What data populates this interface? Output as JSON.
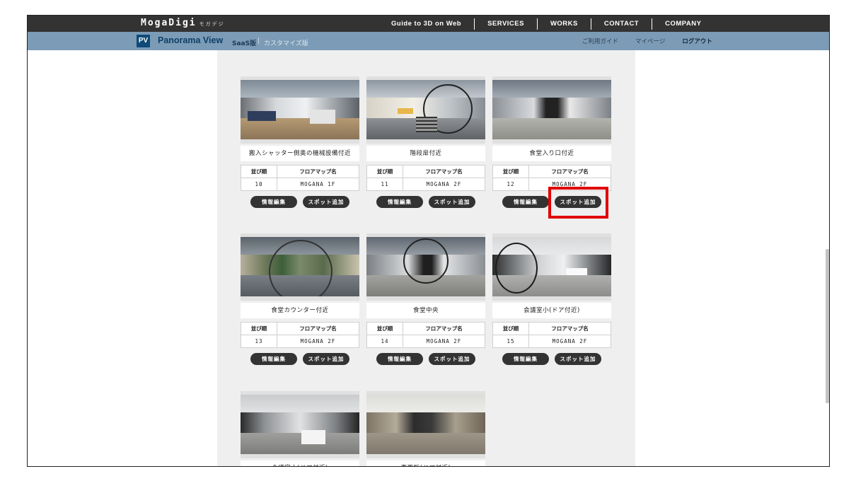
{
  "header": {
    "logo": "MogaDigi",
    "logo_sub": "モガデジ",
    "nav": [
      "Guide to 3D on Web",
      "SERVICES",
      "WORKS",
      "CONTACT",
      "COMPANY"
    ]
  },
  "subheader": {
    "badge": "PV",
    "title": "Panorama View",
    "saas": "SaaS版",
    "separator": "|",
    "custom": "カスタマイズ版",
    "links": [
      "ご利用ガイド",
      "マイページ",
      "ログアウト"
    ]
  },
  "table_headers": {
    "order": "並び順",
    "floor_map": "フロアマップ名"
  },
  "buttons": {
    "edit_info": "情報編集",
    "add_spot": "スポット追加"
  },
  "cards": [
    {
      "title": "搬入シャッター側奥の機械設備付近",
      "order": "10",
      "floor": "MOGANA 1F"
    },
    {
      "title": "階段扉付近",
      "order": "11",
      "floor": "MOGANA 2F"
    },
    {
      "title": "食堂入り口付近",
      "order": "12",
      "floor": "MOGANA 2F"
    },
    {
      "title": "食堂カウンター付近",
      "order": "13",
      "floor": "MOGANA 2F"
    },
    {
      "title": "食堂中央",
      "order": "14",
      "floor": "MOGANA 2F"
    },
    {
      "title": "会議室小(ドア付近)",
      "order": "15",
      "floor": "MOGANA 2F"
    },
    {
      "title": "会議室大(ドア付近)"
    },
    {
      "title": "事務所(ドア付近)"
    }
  ],
  "colors": {
    "topbar": "#333333",
    "subbar": "#7b9bb6",
    "badge": "#0f4a78",
    "highlight": "#e00000"
  }
}
